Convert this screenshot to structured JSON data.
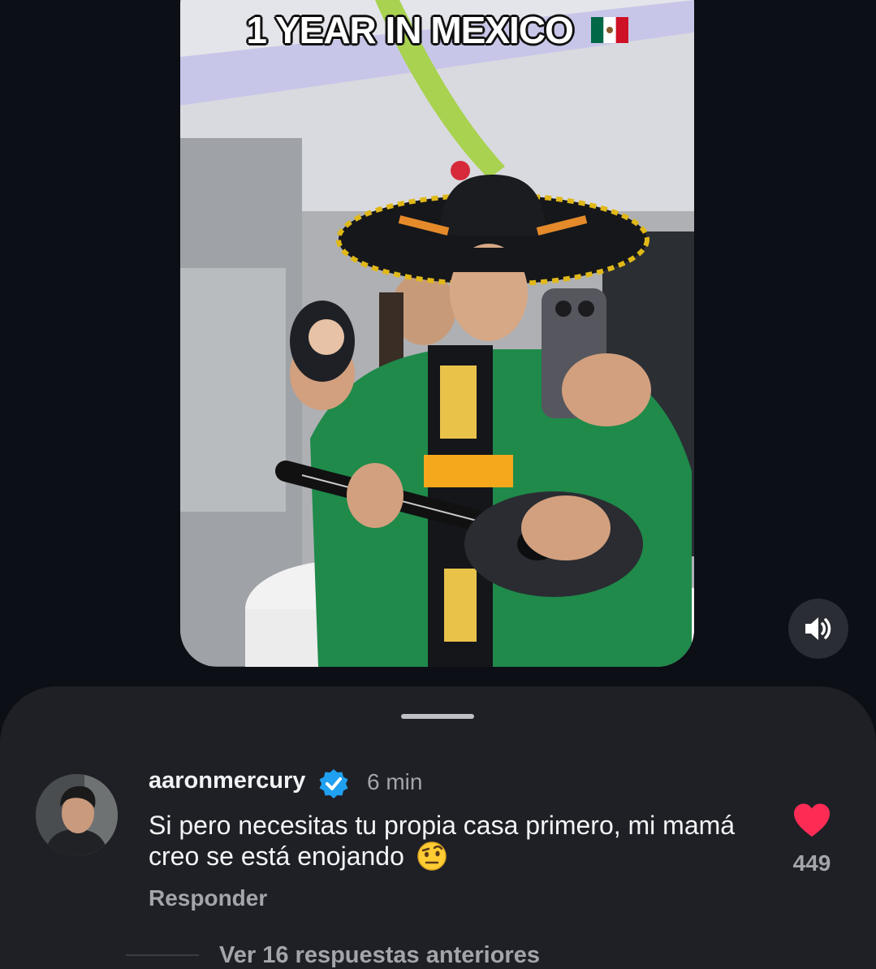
{
  "video": {
    "caption": "1 YEAR IN MEXICO",
    "flag_icon": "mexico-flag-icon"
  },
  "controls": {
    "volume_icon": "speaker-volume-icon"
  },
  "comment": {
    "username": "aaronmercury",
    "verified_icon": "verified-badge-icon",
    "time": "6 min",
    "text": "Si pero necesitas tu propia casa primero, mi mamá creo se está enojando",
    "emoji_icon": "raised-eyebrow-emoji-icon",
    "reply_label": "Responder",
    "like_icon": "heart-icon",
    "like_count": "449",
    "view_replies_label": "Ver 16 respuestas anteriores"
  },
  "colors": {
    "background": "#0c0f15",
    "sheet": "#1f2026",
    "like": "#fe2c55",
    "verified": "#20a0f0",
    "secondary_text": "#a3a5ab"
  }
}
